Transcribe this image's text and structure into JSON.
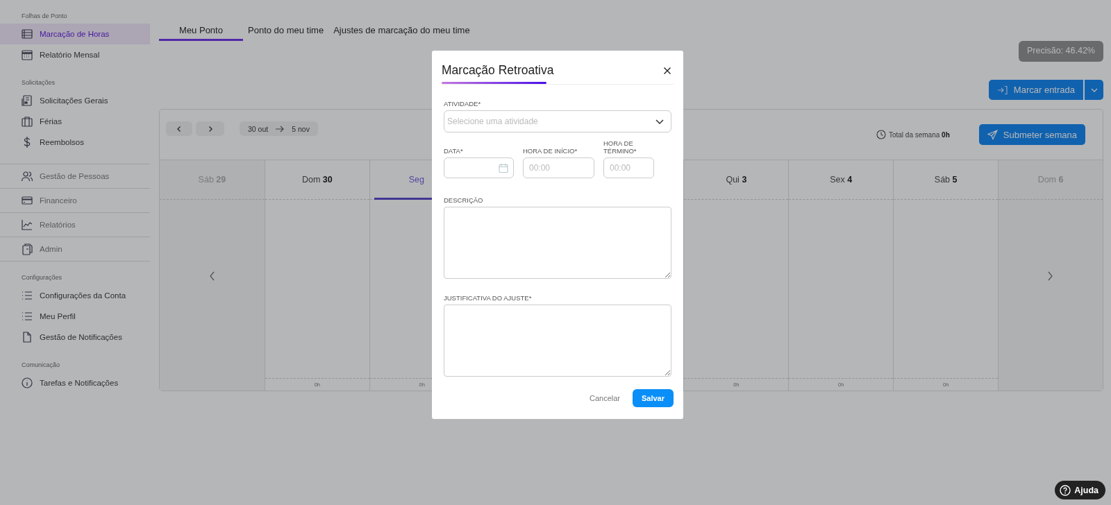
{
  "sidebar": {
    "sections": [
      {
        "title": "Folhas de Ponto",
        "kind": "plain",
        "items": [
          {
            "label": "Marcação de Horas",
            "selected": true
          },
          {
            "label": "Relatório Mensal",
            "selected": false
          }
        ]
      },
      {
        "title": "Solicitações",
        "kind": "plain",
        "items": [
          {
            "label": "Solicitações Gerais",
            "selected": false
          },
          {
            "label": "Férias",
            "selected": false
          },
          {
            "label": "Reembolsos",
            "selected": false
          }
        ]
      },
      {
        "kind": "divided",
        "items": [
          {
            "label": "Gestão de Pessoas",
            "selected": false
          },
          {
            "label": "Financeiro",
            "selected": false
          },
          {
            "label": "Relatórios",
            "selected": false
          },
          {
            "label": "Admin",
            "selected": false
          }
        ]
      },
      {
        "title": "Configurações",
        "kind": "plain",
        "items": [
          {
            "label": "Configurações da Conta",
            "selected": false
          },
          {
            "label": "Meu Perfil",
            "selected": false
          },
          {
            "label": "Gestão de Notificações",
            "selected": false
          }
        ]
      },
      {
        "title": "Comunicação",
        "kind": "plain",
        "items": [
          {
            "label": "Tarefas e Notificações",
            "selected": false
          }
        ]
      }
    ]
  },
  "tabs": [
    {
      "label": "Meu Ponto",
      "selected": true
    },
    {
      "label": "Ponto do meu time",
      "selected": false
    },
    {
      "label": "Ajustes de marcação do meu time",
      "selected": false
    }
  ],
  "precision_badge": "Precisão: 46.42%",
  "clock_in_button": "Marcar entrada",
  "calendar": {
    "range_start": "30 out",
    "range_end": "5 nov",
    "week_total_label": "Total da semana",
    "week_total": "0h",
    "submit_button": "Submeter semana",
    "days": [
      {
        "weekday": "Sáb",
        "day": "29",
        "dimmed": true,
        "selected": false
      },
      {
        "weekday": "Dom",
        "day": "30",
        "dimmed": false,
        "selected": false,
        "total": "0h"
      },
      {
        "weekday": "Seg",
        "dimmed": false,
        "selected": true,
        "total": "0h"
      },
      {
        "weekday": "Qui",
        "day": "3",
        "dimmed": false,
        "selected": false,
        "total": "0h"
      },
      {
        "weekday": "Sex",
        "day": "4",
        "dimmed": false,
        "selected": false,
        "total": "0h"
      },
      {
        "weekday": "Sáb",
        "day": "5",
        "dimmed": false,
        "selected": false,
        "total": "0h"
      },
      {
        "weekday": "Dom",
        "day": "6",
        "dimmed": true,
        "selected": false
      }
    ]
  },
  "modal": {
    "title": "Marcação Retroativa",
    "activity": {
      "label": "ATIVIDADE*",
      "placeholder": "Selecione uma atividade"
    },
    "date": {
      "label": "DATA*"
    },
    "start": {
      "label": "HORA DE INÍCIO*",
      "placeholder": "00:00"
    },
    "end": {
      "label": "HORA DE TÉRMINO*",
      "placeholder": "00:00"
    },
    "description": {
      "label": "DESCRIÇÃO"
    },
    "justification": {
      "label": "JUSTIFICATIVA DO AJUSTE*"
    },
    "cancel_button": "Cancelar",
    "save_button": "Salvar"
  },
  "help_button": "Ajuda"
}
